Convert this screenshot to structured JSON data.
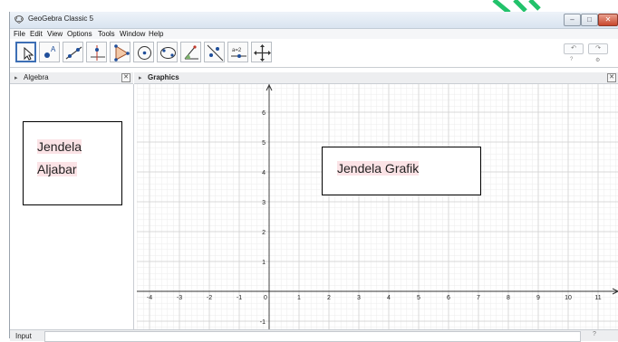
{
  "window": {
    "title": "GeoGebra Classic 5",
    "controls": [
      "–",
      "□",
      "✕"
    ]
  },
  "menu": [
    "File",
    "Edit",
    "View",
    "Options",
    "Tools",
    "Window",
    "Help"
  ],
  "toolbar": {
    "tools": [
      "move-tool",
      "point-tool",
      "line-tool",
      "perpendicular-tool",
      "polygon-tool",
      "circle-tool",
      "conic-tool",
      "angle-tool",
      "reflect-tool",
      "slider-tool",
      "move-view-tool"
    ],
    "slider_text": "a=2",
    "point_label": "A",
    "undo": "↶",
    "redo": "↷",
    "help_glyph": "?",
    "settings_glyph": "⚙"
  },
  "algebra": {
    "header": "Algebra",
    "callout_line1": "Jendela",
    "callout_line2": "Aljabar"
  },
  "graphics": {
    "header": "Graphics",
    "callout": "Jendela Grafik",
    "x_ticks": [
      "-4",
      "-3",
      "-2",
      "-1",
      "0",
      "1",
      "2",
      "3",
      "4",
      "5",
      "6",
      "7",
      "8",
      "9",
      "10",
      "11"
    ],
    "y_ticks": [
      "6",
      "5",
      "4",
      "3",
      "2",
      "1",
      "-1"
    ]
  },
  "input": {
    "label": "Input",
    "help": "?"
  },
  "colors": {
    "highlight": "#fbe3e6",
    "grid_minor": "#ececec",
    "grid_major": "#cfcfcf",
    "active_tool": "#3d6fb5",
    "watermark": "#22c26b"
  }
}
